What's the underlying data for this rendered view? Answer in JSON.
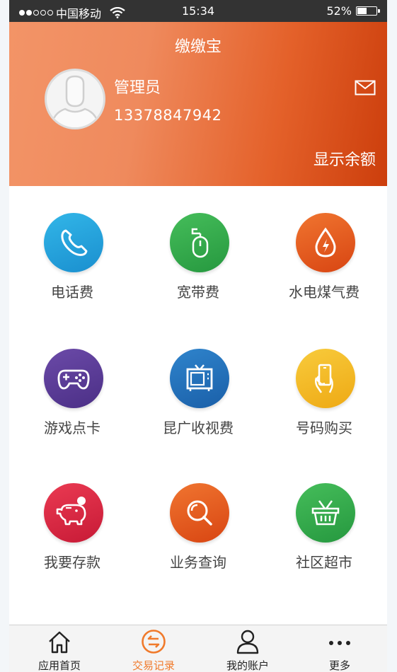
{
  "status_bar": {
    "carrier": "中国移动",
    "time": "15:34",
    "battery_percent": "52%",
    "battery_level": 0.52,
    "signal_bars_filled": 2,
    "signal_bars_total": 5
  },
  "header": {
    "title": "缴缴宝",
    "username": "管理员",
    "phone": "13378847942",
    "balance_link": "显示余额"
  },
  "services": [
    {
      "label": "电话费",
      "icon": "phone-icon",
      "color": "#1d9fd6"
    },
    {
      "label": "宽带费",
      "icon": "mouse-icon",
      "color": "#2ea547"
    },
    {
      "label": "水电煤气费",
      "icon": "utility-drop-icon",
      "color": "#e5561a"
    },
    {
      "label": "游戏点卡",
      "icon": "gamepad-icon",
      "color": "#5b3d96"
    },
    {
      "label": "昆广收视费",
      "icon": "tv-icon",
      "color": "#1f6fb8"
    },
    {
      "label": "号码购买",
      "icon": "hand-phone-icon",
      "color": "#f1b51f"
    },
    {
      "label": "我要存款",
      "icon": "piggy-bank-icon",
      "color": "#d9213e"
    },
    {
      "label": "业务查询",
      "icon": "magnifier-icon",
      "color": "#e5561a"
    },
    {
      "label": "社区超市",
      "icon": "basket-icon",
      "color": "#2ea547"
    }
  ],
  "tabbar": [
    {
      "label": "应用首页",
      "icon": "home-icon",
      "active": false
    },
    {
      "label": "交易记录",
      "icon": "transactions-icon",
      "active": true
    },
    {
      "label": "我的账户",
      "icon": "account-icon",
      "active": false
    },
    {
      "label": "更多",
      "icon": "more-icon",
      "active": false
    }
  ],
  "colors": {
    "header_start": "#f39467",
    "header_end": "#cc3e0c",
    "tab_active": "#f07a2b"
  }
}
